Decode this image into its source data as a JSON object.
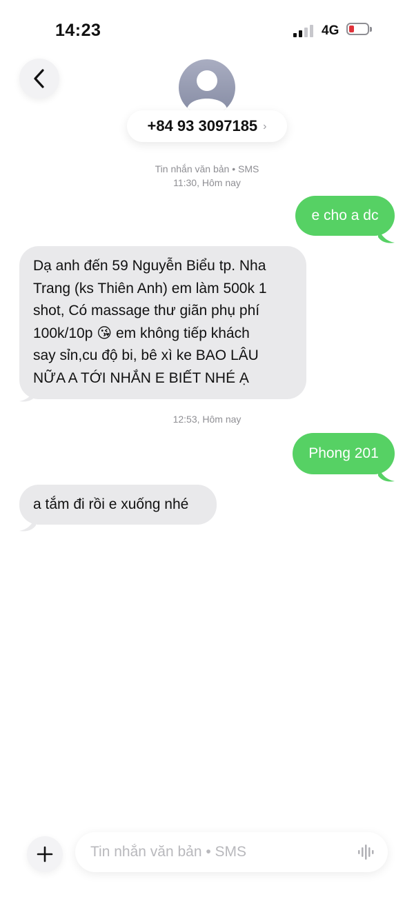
{
  "status_bar": {
    "time": "14:23",
    "network": "4G",
    "battery_level": 0.12,
    "battery_color": "#e0323a"
  },
  "header": {
    "contact_number": "+84 93 3097185",
    "chevron": "›",
    "avatar_icon": "person-silhouette-icon"
  },
  "thread_info": {
    "channel": "Tin nhắn văn bản • SMS",
    "time": "11:30, Hôm nay"
  },
  "messages": [
    {
      "direction": "sent",
      "text": "e cho a dc"
    },
    {
      "direction": "received",
      "lines": [
        "Dạ anh đến 59 Nguyễn Biểu tp. Nha",
        "Trang (ks Thiên Anh) em làm 500k 1",
        "shot, Có massage thư giãn phụ phí",
        "100k/10p 😘 em không tiếp khách",
        "say sỉn,cu độ bi, bê xì ke BAO LÂU",
        "NỮA A TỚI NHẮN E BIẾT NHÉ Ạ"
      ]
    },
    {
      "direction": "sent",
      "text": "Phong 201"
    },
    {
      "direction": "received",
      "text": "a tắm đi rồi e xuống nhé"
    }
  ],
  "time_separator_2": "12:53, Hôm nay",
  "composer": {
    "placeholder": "Tin nhắn văn bản • SMS",
    "plus_icon": "plus-icon",
    "dictation_icon": "waveform-icon"
  },
  "colors": {
    "sent_bubble": "#56d164",
    "received_bubble": "#e9e9eb",
    "meta_text": "#8e8e93"
  }
}
